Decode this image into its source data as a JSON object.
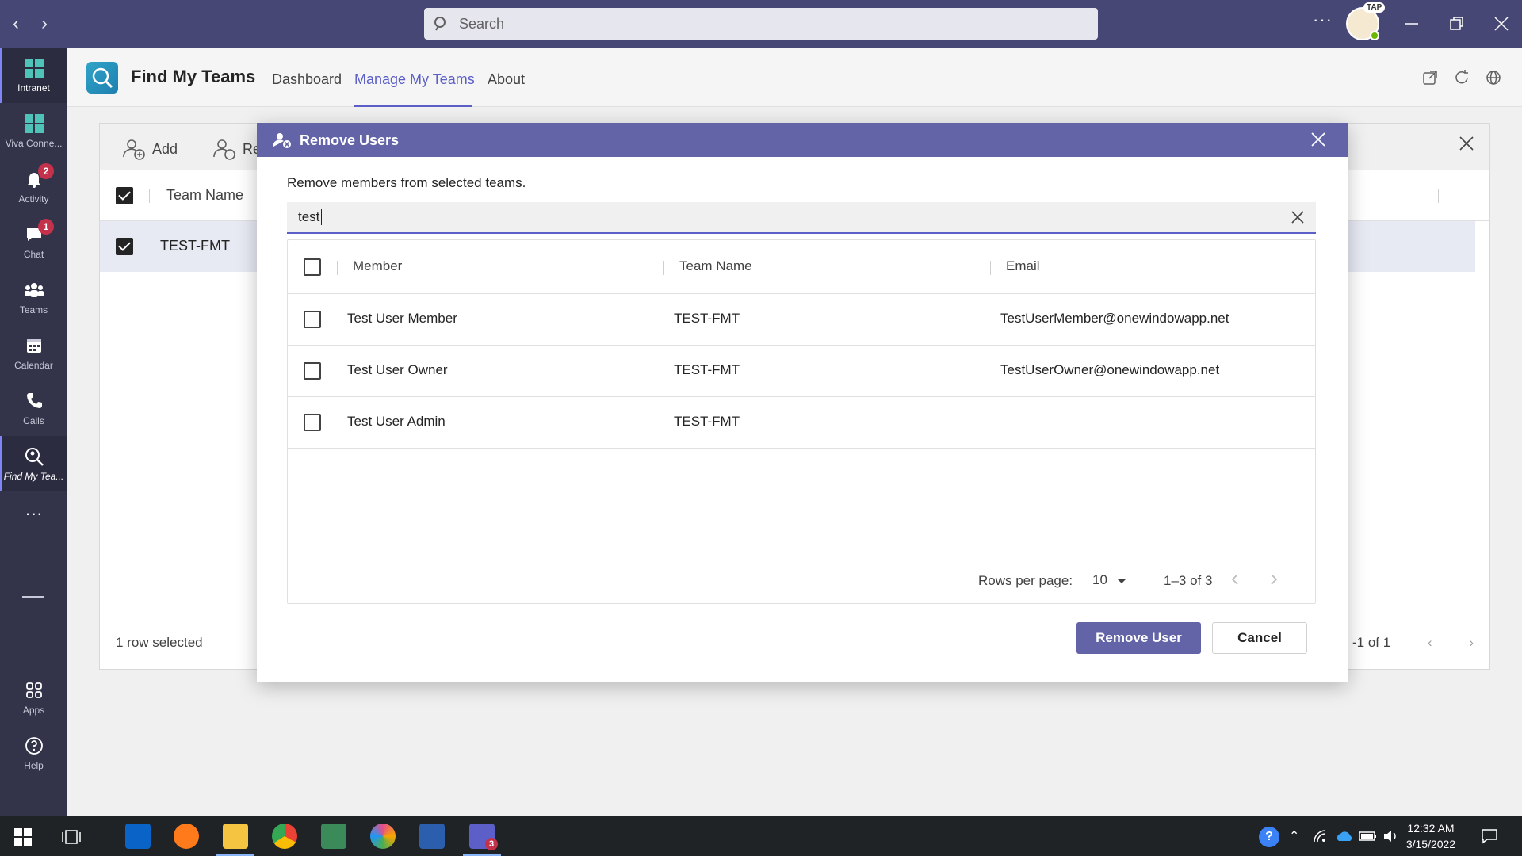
{
  "titlebar": {
    "search_placeholder": "Search",
    "more_label": "···",
    "avatar_tag": "TAP"
  },
  "rail": {
    "items": [
      {
        "label": "Intranet"
      },
      {
        "label": "Viva Conne..."
      },
      {
        "label": "Activity",
        "badge": "2"
      },
      {
        "label": "Chat",
        "badge": "1"
      },
      {
        "label": "Teams"
      },
      {
        "label": "Calendar"
      },
      {
        "label": "Calls"
      },
      {
        "label": "Find My Tea..."
      },
      {
        "label": "···"
      },
      {
        "label": "Apps"
      },
      {
        "label": "Help"
      }
    ]
  },
  "app": {
    "title": "Find My Teams",
    "tabs": [
      "Dashboard",
      "Manage My Teams",
      "About"
    ],
    "active_tab": "Manage My Teams"
  },
  "background": {
    "toolbar_add": "Add",
    "toolbar_remove_partial": "Re",
    "column_team_name": "Team Name",
    "row_team": "TEST-FMT",
    "footer_selected": "1 row selected",
    "footer_range": "-1 of 1"
  },
  "dialog": {
    "title": "Remove Users",
    "description": "Remove members from selected teams.",
    "search_value": "test",
    "columns": [
      "Member",
      "Team Name",
      "Email"
    ],
    "rows": [
      {
        "member": "Test User Member",
        "team": "TEST-FMT",
        "email": "TestUserMember@onewindowapp.net"
      },
      {
        "member": "Test User Owner",
        "team": "TEST-FMT",
        "email": "TestUserOwner@onewindowapp.net"
      },
      {
        "member": "Test User Admin",
        "team": "TEST-FMT",
        "email": ""
      }
    ],
    "rows_per_page_label": "Rows per page:",
    "rows_per_page_value": "10",
    "range": "1–3 of 3",
    "primary_button": "Remove User",
    "secondary_button": "Cancel"
  },
  "taskbar": {
    "time": "12:32 AM",
    "date": "3/15/2022",
    "teams_badge": "3"
  },
  "colors": {
    "titlebar": "#464775",
    "rail": "#33344a",
    "accent": "#6264a7",
    "accent_text": "#5b5fc7"
  }
}
